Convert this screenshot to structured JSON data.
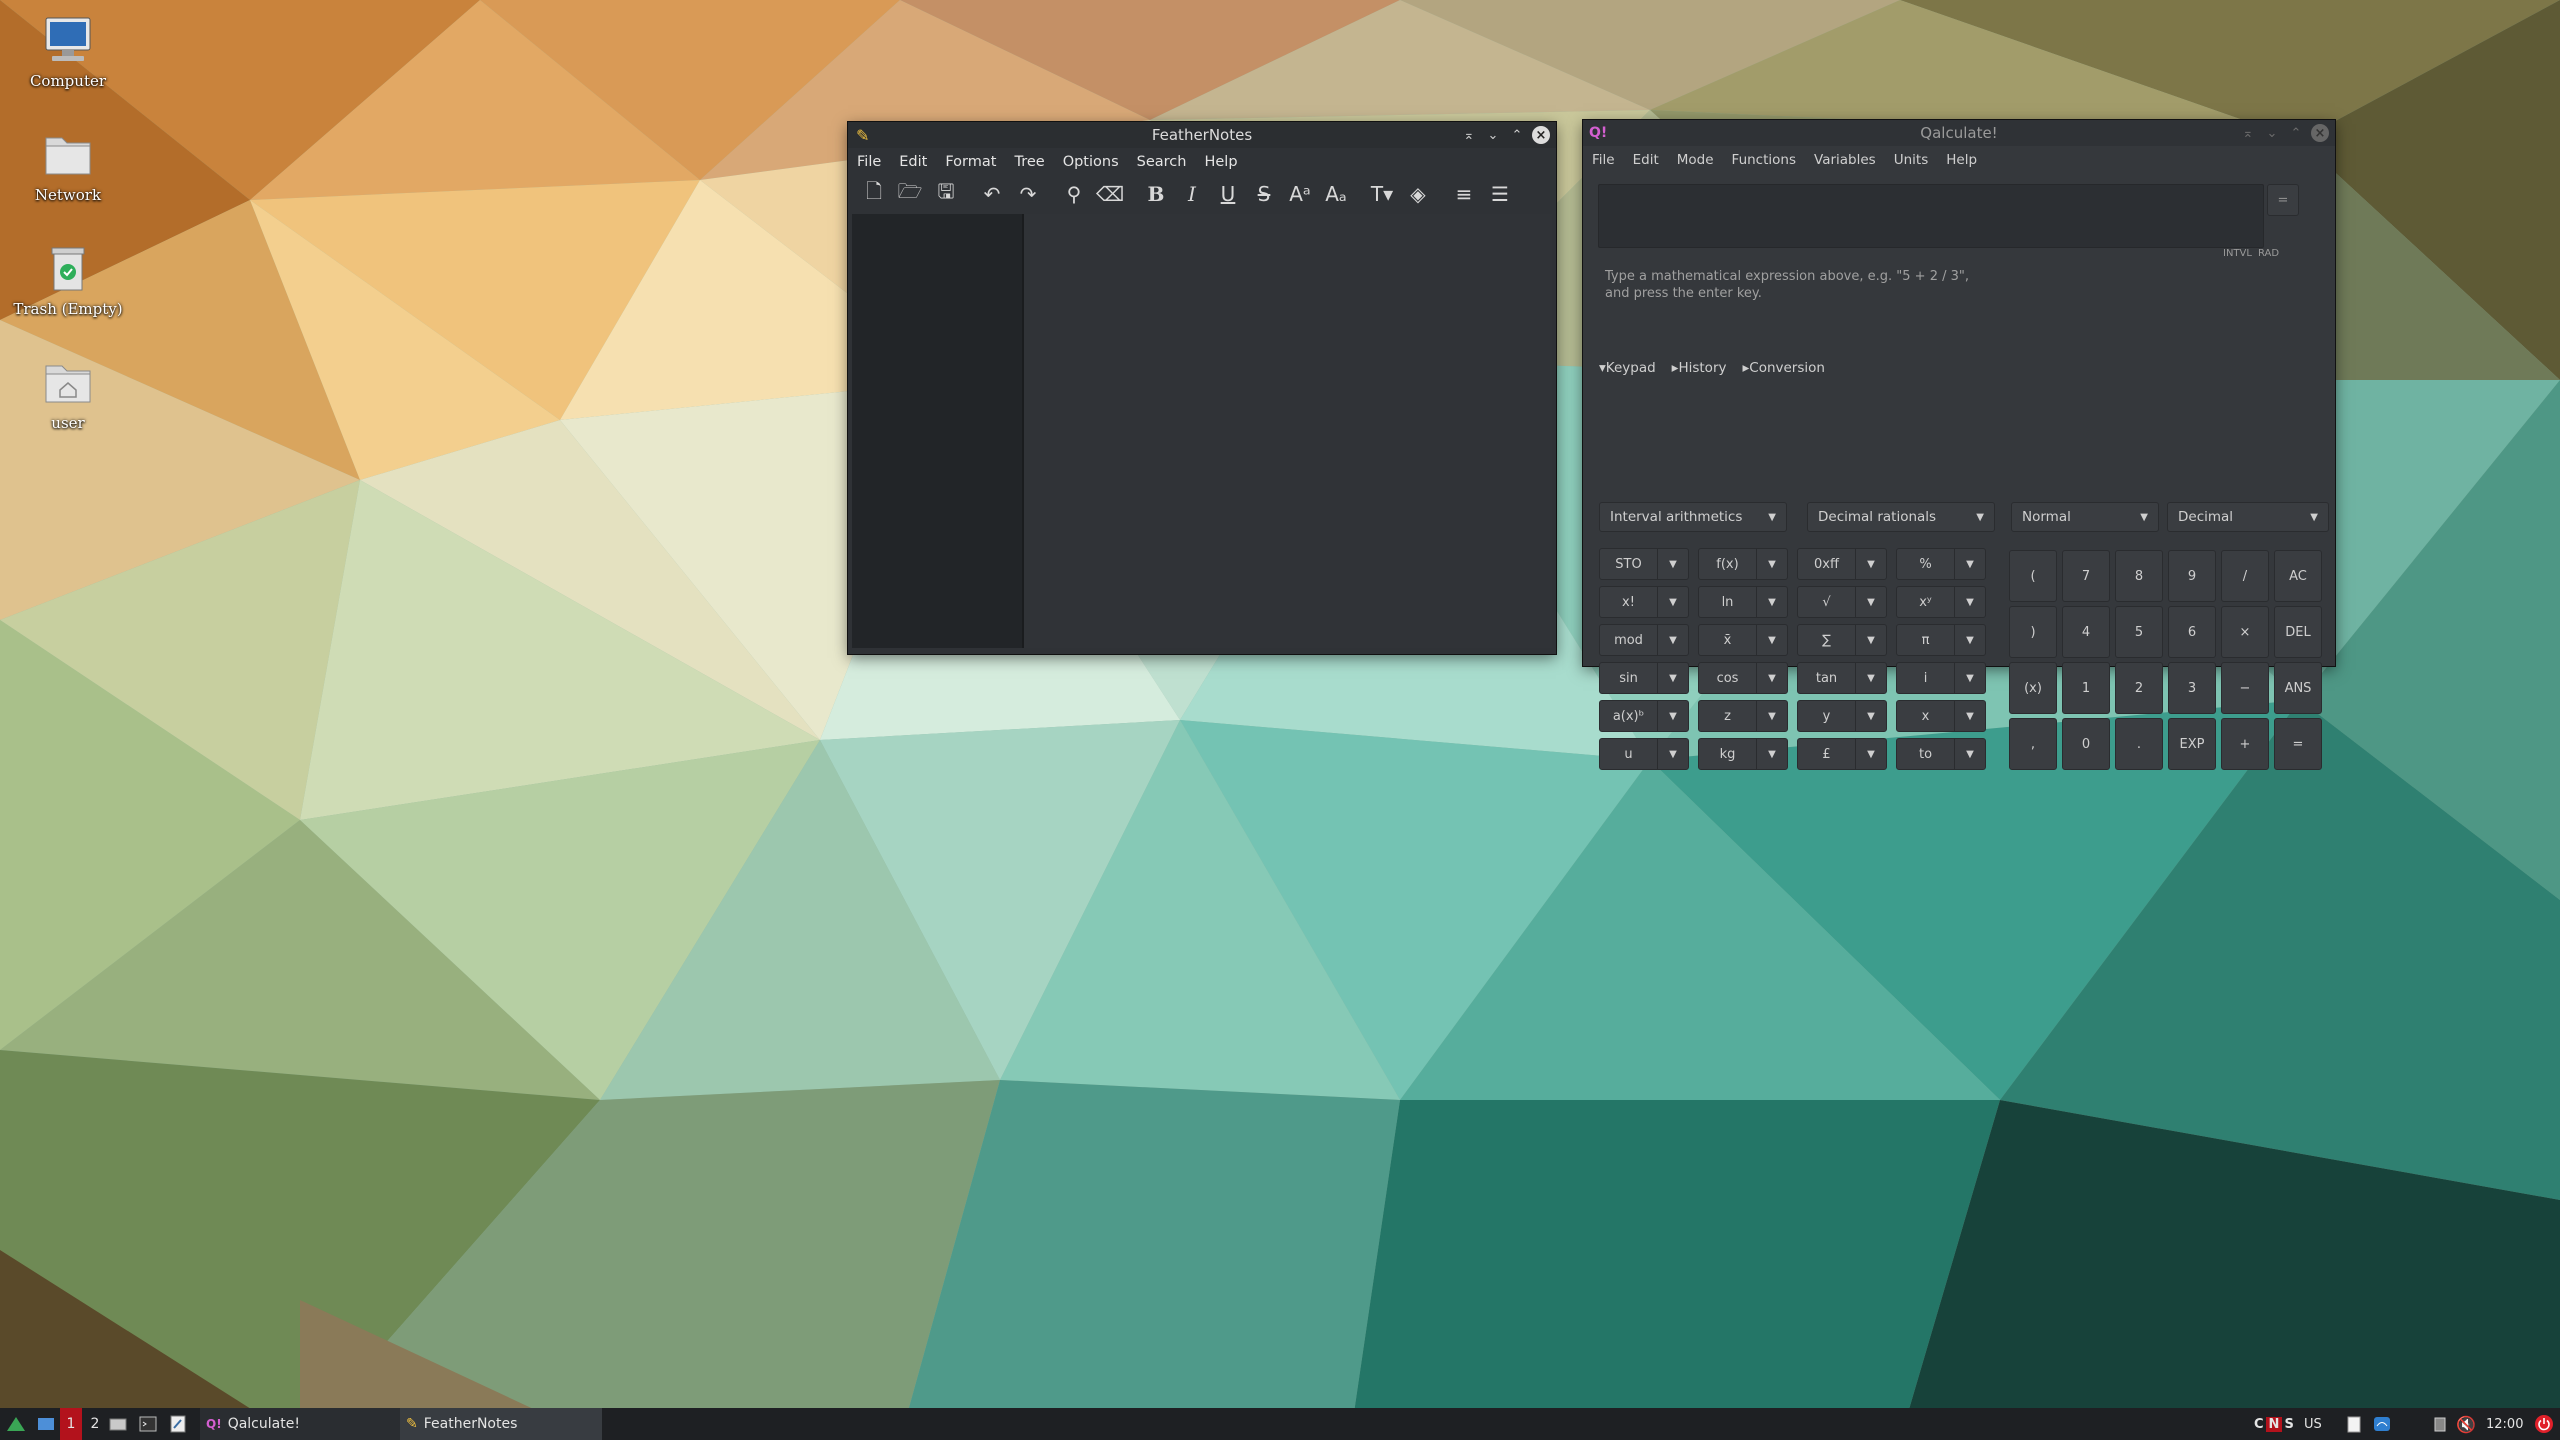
{
  "desktop": {
    "icons": [
      {
        "label": "Computer",
        "icon": "computer-icon"
      },
      {
        "label": "Network",
        "icon": "folder-icon"
      },
      {
        "label": "Trash (Empty)",
        "icon": "trash-icon"
      },
      {
        "label": "user",
        "icon": "home-folder-icon"
      }
    ]
  },
  "feathernotes": {
    "title": "FeatherNotes",
    "menu": [
      "File",
      "Edit",
      "Format",
      "Tree",
      "Options",
      "Search",
      "Help"
    ]
  },
  "qalculate": {
    "title": "Qalculate!",
    "menu": [
      "File",
      "Edit",
      "Mode",
      "Functions",
      "Variables",
      "Units",
      "Help"
    ],
    "equals": "=",
    "status": [
      "INTVL",
      "RAD"
    ],
    "hint_line1": "Type a mathematical expression above, e.g. \"5 + 2 / 3\",",
    "hint_line2": "and press the enter key.",
    "tabs": [
      "Keypad",
      "History",
      "Conversion"
    ],
    "combos": [
      "Interval arithmetics",
      "Decimal rationals",
      "Normal",
      "Decimal"
    ],
    "function_keys": [
      [
        "STO",
        "f(x)",
        "0xff",
        "%"
      ],
      [
        "x!",
        "ln",
        "√",
        "xʸ"
      ],
      [
        "mod",
        "x̄",
        "∑",
        "π"
      ],
      [
        "sin",
        "cos",
        "tan",
        "i"
      ],
      [
        "a(x)ᵇ",
        "z",
        "y",
        "x"
      ],
      [
        "u",
        "kg",
        "£",
        "to"
      ]
    ],
    "numpad": [
      [
        "(",
        "7",
        "8",
        "9",
        "/",
        "AC"
      ],
      [
        ")",
        "4",
        "5",
        "6",
        "×",
        "DEL"
      ],
      [
        "(x)",
        "1",
        "2",
        "3",
        "−",
        "ANS"
      ],
      [
        ",",
        "0",
        ".",
        "EXP",
        "+",
        "="
      ]
    ]
  },
  "taskbar": {
    "workspaces": [
      "1",
      "2"
    ],
    "tasks": [
      "Qalculate!",
      "FeatherNotes"
    ],
    "indicators": [
      "C",
      "N",
      "S"
    ],
    "keyboard_layout": "US",
    "clock": "12:00",
    "colors": {
      "workspace_active": "#b3121c",
      "power": "#e0202a"
    }
  }
}
